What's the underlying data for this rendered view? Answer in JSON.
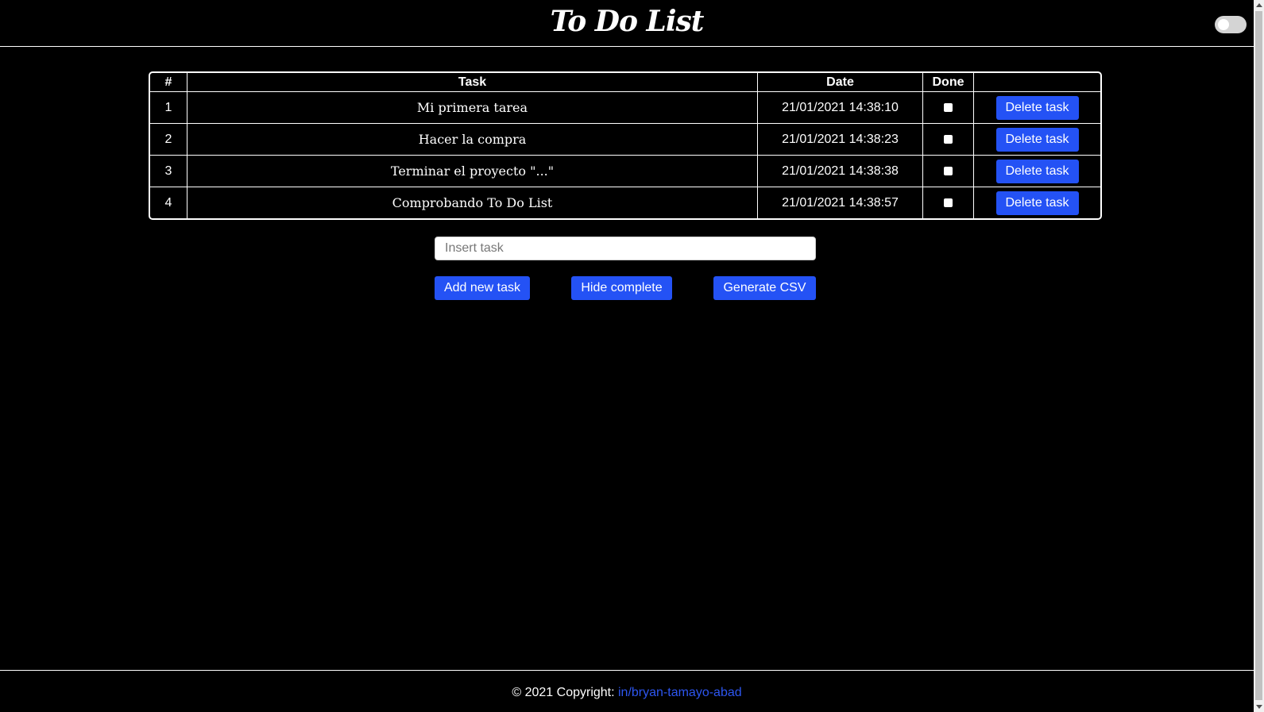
{
  "header": {
    "title": "To Do List",
    "theme_toggle": "off"
  },
  "table": {
    "columns": [
      "#",
      "Task",
      "Date",
      "Done",
      ""
    ],
    "rows": [
      {
        "num": "1",
        "task": "Mi primera tarea",
        "date": "21/01/2021 14:38:10",
        "done": false,
        "action": "Delete task"
      },
      {
        "num": "2",
        "task": "Hacer la compra",
        "date": "21/01/2021 14:38:23",
        "done": false,
        "action": "Delete task"
      },
      {
        "num": "3",
        "task": "Terminar el proyecto \"...\"",
        "date": "21/01/2021 14:38:38",
        "done": false,
        "action": "Delete task"
      },
      {
        "num": "4",
        "task": "Comprobando To Do List",
        "date": "21/01/2021 14:38:57",
        "done": false,
        "action": "Delete task"
      }
    ]
  },
  "form": {
    "task_input_value": "",
    "task_input_placeholder": "Insert task",
    "add_label": "Add new task",
    "hide_label": "Hide complete",
    "csv_label": "Generate CSV"
  },
  "footer": {
    "copyright_text": "© 2021 Copyright: ",
    "link_text": "in/bryan-tamayo-abad"
  },
  "colors": {
    "background": "#000000",
    "button_blue": "#2452f5",
    "link_blue": "#2d56f0",
    "text": "#ffffff"
  }
}
